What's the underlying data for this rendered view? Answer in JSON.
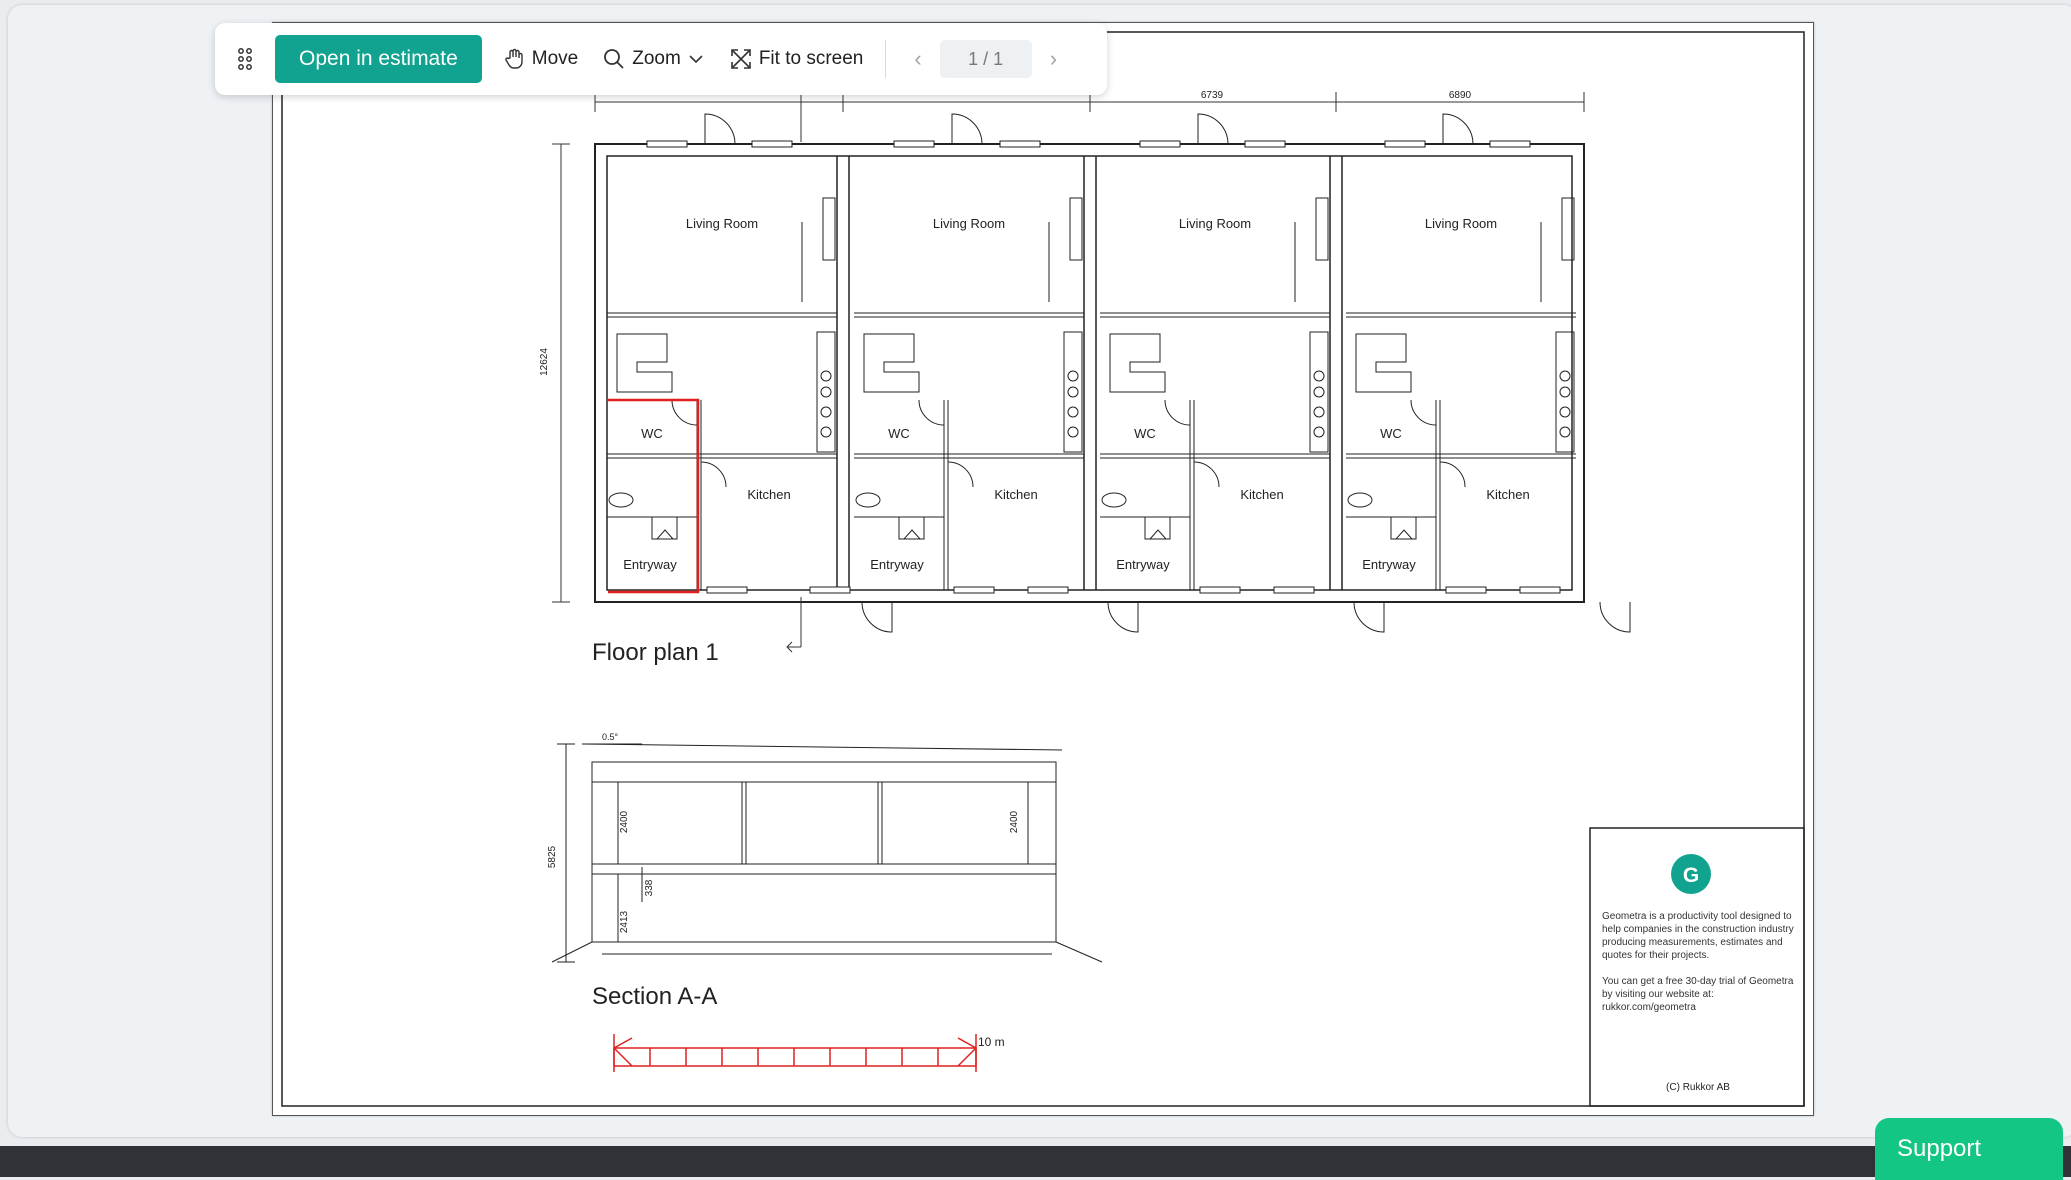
{
  "toolbar": {
    "open_estimate_label": "Open in estimate",
    "move_label": "Move",
    "zoom_label": "Zoom",
    "fit_label": "Fit to screen",
    "page_indicator": "1 / 1",
    "prev_icon": "chevron-left-icon",
    "next_icon": "chevron-right-icon",
    "grip_icon": "grip-dots-icon",
    "accent_color": "#11a38f"
  },
  "drawing": {
    "dimensions_top": [
      "6739",
      "6890"
    ],
    "dimension_left": "12624",
    "units": [
      {
        "living": "Living Room",
        "wc": "WC",
        "kitchen": "Kitchen",
        "entry": "Entryway"
      },
      {
        "living": "Living Room",
        "wc": "WC",
        "kitchen": "Kitchen",
        "entry": "Entryway"
      },
      {
        "living": "Living Room",
        "wc": "WC",
        "kitchen": "Kitchen",
        "entry": "Entryway"
      },
      {
        "living": "Living Room",
        "wc": "WC",
        "kitchen": "Kitchen",
        "entry": "Entryway"
      }
    ],
    "floor_plan_title": "Floor plan 1",
    "section_title": "Section A-A",
    "section_dims": {
      "slope": "0.5°",
      "height_total": "5825",
      "h1": "2400",
      "h2": "2400",
      "h3": "338",
      "h4": "2413"
    },
    "scale_label": "10 m"
  },
  "info_box": {
    "logo_letter": "G",
    "text_1": "Geometra is a productivity tool designed to help companies in the construction industry producing measurements, estimates and quotes for their projects.",
    "text_2": "You can get a free 30-day trial of Geometra by visiting our website at: rukkor.com/geometra",
    "copyright": "(C) Rukkor AB"
  },
  "support_label": "Support",
  "colors": {
    "support": "#13c683",
    "bottom_bar": "#2f3236",
    "highlight": "#e02020"
  }
}
